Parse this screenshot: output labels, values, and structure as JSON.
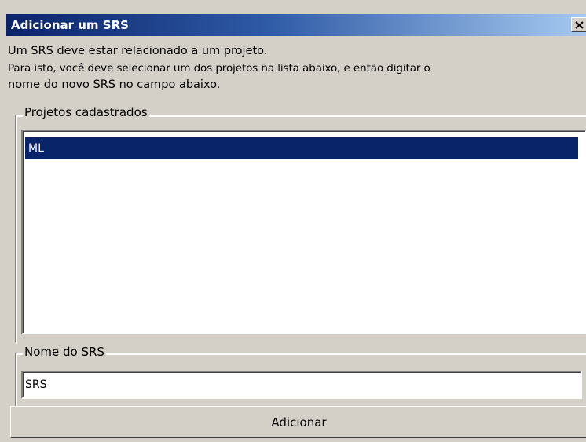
{
  "window": {
    "title": "Adicionar um SRS",
    "close_icon": "close-icon"
  },
  "intro": {
    "line1": "Um SRS deve estar relacionado a um projeto.",
    "line2": "Para isto, você deve selecionar um dos projetos na lista abaixo, e então digitar o",
    "line3": "nome do novo SRS no campo abaixo."
  },
  "projects_group": {
    "legend": "Projetos cadastrados",
    "items": [
      {
        "label": "ML",
        "selected": true
      }
    ]
  },
  "name_group": {
    "legend": "Nome do SRS",
    "value": "SRS"
  },
  "actions": {
    "add_label": "Adicionar"
  },
  "colors": {
    "title_start": "#0a246a",
    "title_end": "#a6caf0",
    "face": "#d4d0c8",
    "selection": "#0a246a"
  }
}
